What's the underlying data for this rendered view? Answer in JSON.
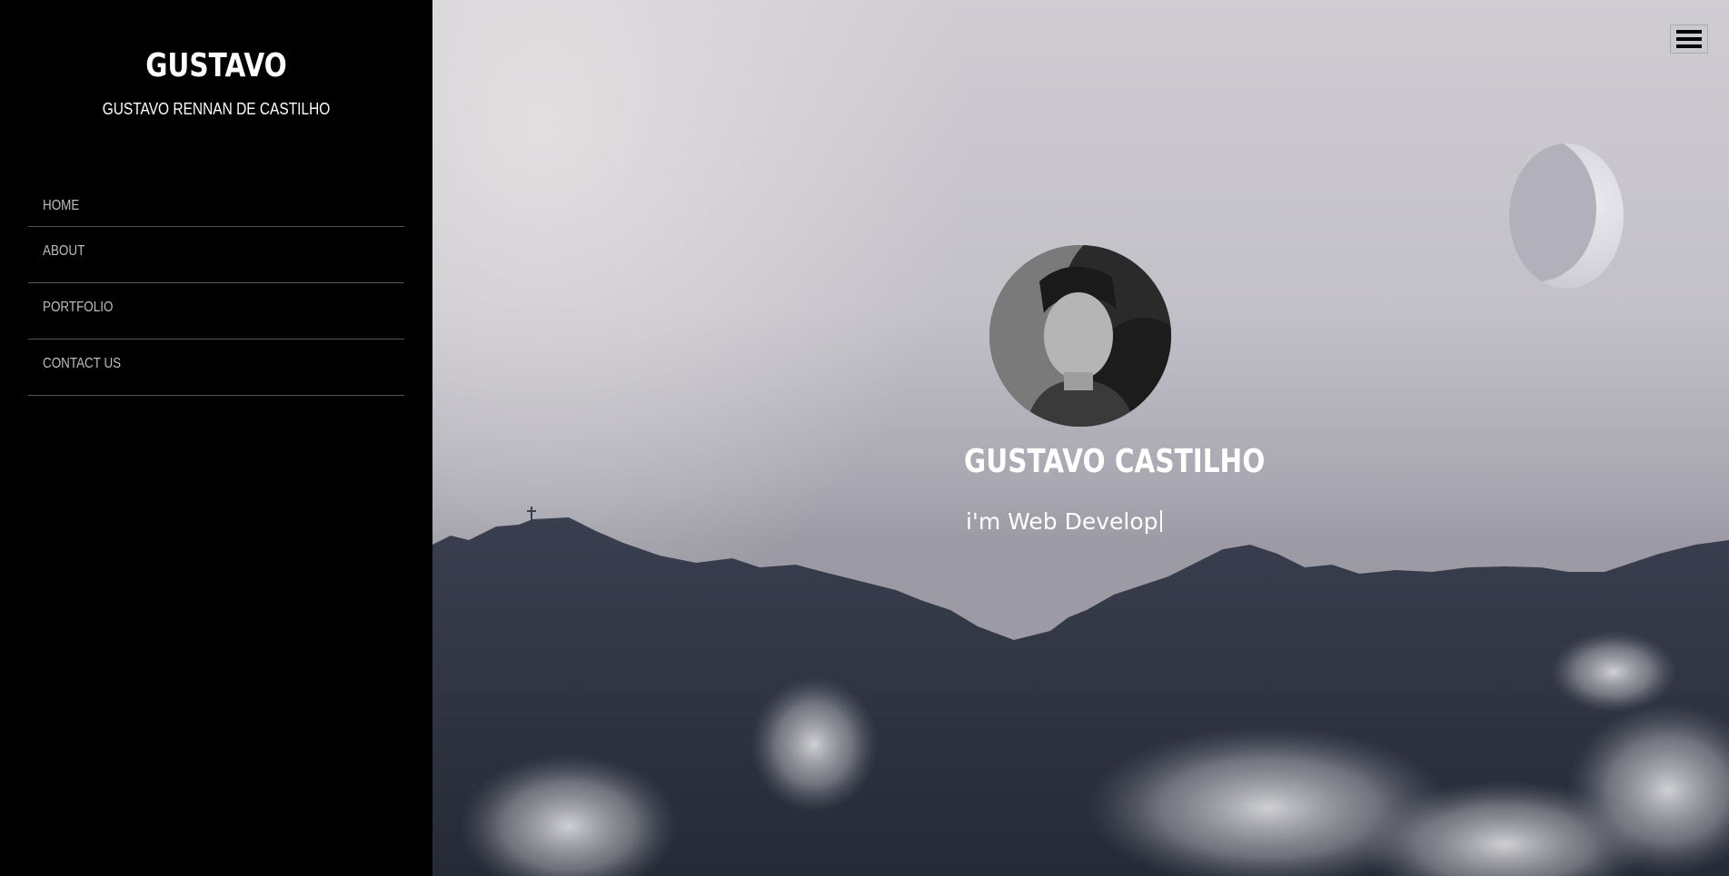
{
  "sidebar": {
    "brand": "GUSTAVO",
    "tagline": "GUSTAVO RENNAN DE CASTILHO",
    "nav": [
      {
        "label": "HOME"
      },
      {
        "label": "ABOUT"
      },
      {
        "label": "PORTFOLIO"
      },
      {
        "label": "CONTACT US"
      }
    ]
  },
  "hero": {
    "name": "GUSTAVO CASTILHO",
    "role": "i'm Web Develop",
    "menu_icon": "hamburger-icon"
  },
  "colors": {
    "sidebar_bg": "#000000",
    "nav_text": "#bdbdbd",
    "hero_text": "#ffffff",
    "mountain": "#2f3444"
  }
}
